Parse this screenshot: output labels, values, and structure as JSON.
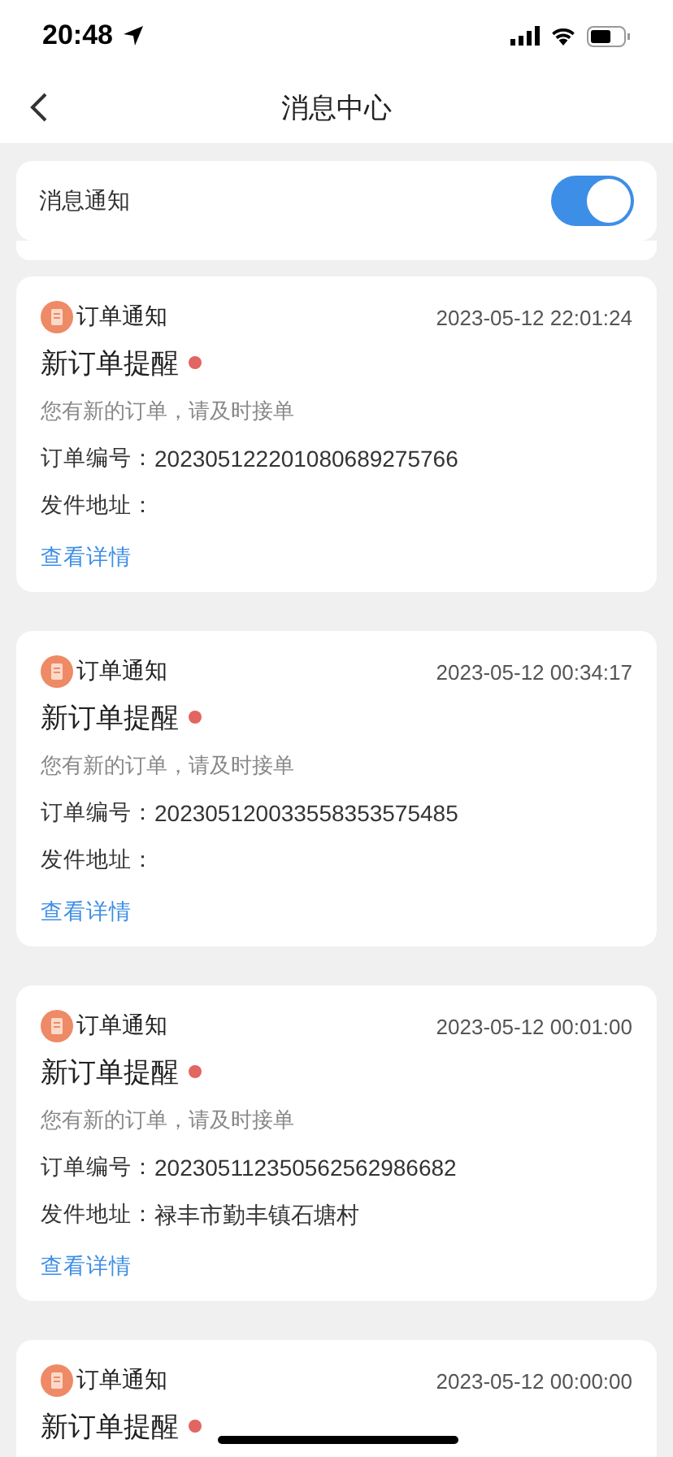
{
  "status_bar": {
    "time": "20:48"
  },
  "nav": {
    "title": "消息中心"
  },
  "setting": {
    "label": "消息通知",
    "on": true
  },
  "messages": [
    {
      "category": "订单通知",
      "time": "2023-05-12 22:01:24",
      "title": "新订单提醒",
      "unread": true,
      "description": "您有新的订单，请及时接单",
      "order_label": "订单编号：",
      "order_no": "202305122201080689275766",
      "address_label": "发件地址：",
      "link": "查看详情"
    },
    {
      "category": "订单通知",
      "time": "2023-05-12 00:34:17",
      "title": "新订单提醒",
      "unread": true,
      "description": "您有新的订单，请及时接单",
      "order_label": "订单编号：",
      "order_no": "202305120033558353575485",
      "address_label": "发件地址：",
      "link": "查看详情"
    },
    {
      "category": "订单通知",
      "time": "2023-05-12 00:01:00",
      "title": "新订单提醒",
      "unread": true,
      "description": "您有新的订单，请及时接单",
      "order_label": "订单编号：",
      "order_no": "202305112350562562986682",
      "address_label": "发件地址：",
      "address": "禄丰市勤丰镇石塘村",
      "link": "查看详情"
    },
    {
      "category": "订单通知",
      "time": "2023-05-12 00:00:00",
      "title": "新订单提醒",
      "unread": true
    }
  ]
}
